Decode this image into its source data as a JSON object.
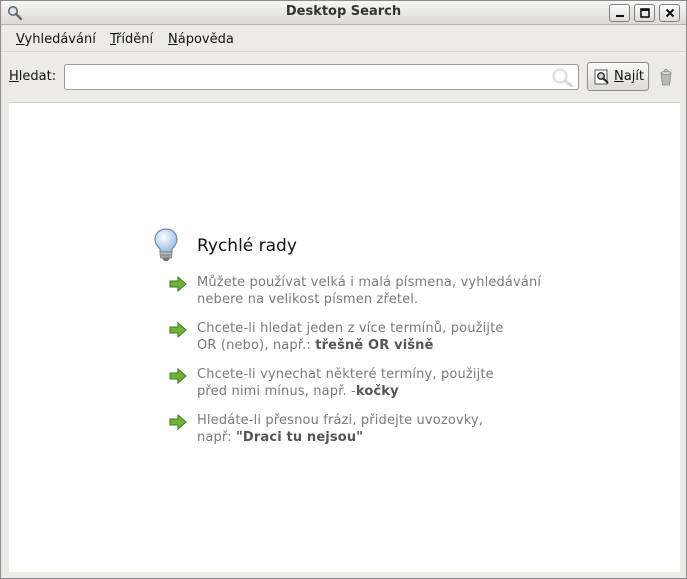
{
  "window": {
    "title": "Desktop Search"
  },
  "menubar": {
    "items": [
      "Vyhledávání",
      "Třídění",
      "Nápověda"
    ]
  },
  "search": {
    "label": "Hledat:",
    "value": "",
    "placeholder": "",
    "find_label": "Najít"
  },
  "tips": {
    "title": "Rychlé rady",
    "items": [
      {
        "line1": "Můžete používat velká i malá písmena, vyhledávání",
        "line2": "nebere na velikost písmen zřetel.",
        "line2_bold": ""
      },
      {
        "line1": "Chcete-li hledat jeden z více termínů, použijte",
        "line2": "OR (nebo), např.: ",
        "line2_bold": "třešně OR višně"
      },
      {
        "line1": "Chcete-li vynechat některé termíny, použijte",
        "line2": "před nimi mínus, např. -",
        "line2_bold": "kočky"
      },
      {
        "line1": "Hledáte-li přesnou frázi, přidejte uvozovky,",
        "line2": "např: ",
        "line2_bold": "\"Draci tu nejsou\""
      }
    ]
  },
  "colors": {
    "arrow_green": "#5aa02c",
    "hint_text": "#7a7a7a"
  },
  "icons": [
    "app-search-icon",
    "minimize-icon",
    "maximize-icon",
    "close-icon",
    "magnifier-icon",
    "find-icon",
    "throbber-icon",
    "lightbulb-icon",
    "arrow-right-icon"
  ]
}
